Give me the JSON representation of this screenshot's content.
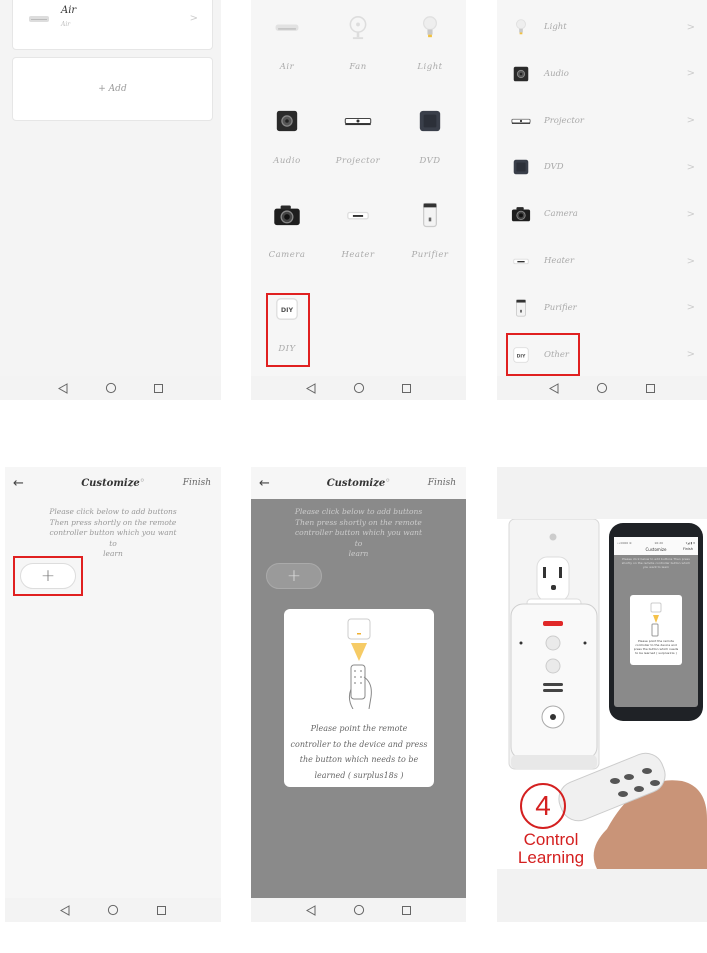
{
  "panel1": {
    "device_name": "Air",
    "device_sub": "Air",
    "chevron": ">",
    "add_label": "+ Add"
  },
  "panel2": {
    "grid": [
      {
        "label": "Air",
        "icon": "air-conditioner-icon"
      },
      {
        "label": "Fan",
        "icon": "fan-icon"
      },
      {
        "label": "Light",
        "icon": "light-bulb-icon"
      },
      {
        "label": "Audio",
        "icon": "audio-speaker-icon"
      },
      {
        "label": "Projector",
        "icon": "projector-icon"
      },
      {
        "label": "DVD",
        "icon": "dvd-icon"
      },
      {
        "label": "Camera",
        "icon": "camera-icon"
      },
      {
        "label": "Heater",
        "icon": "heater-icon"
      },
      {
        "label": "Purifier",
        "icon": "purifier-icon"
      },
      {
        "label": "DIY",
        "icon": "diy-icon"
      }
    ],
    "diy_badge": "DIY"
  },
  "panel3": {
    "list": [
      {
        "label": "Light",
        "icon": "light-bulb-icon"
      },
      {
        "label": "Audio",
        "icon": "audio-speaker-icon"
      },
      {
        "label": "Projector",
        "icon": "projector-icon"
      },
      {
        "label": "DVD",
        "icon": "dvd-icon"
      },
      {
        "label": "Camera",
        "icon": "camera-icon"
      },
      {
        "label": "Heater",
        "icon": "heater-icon"
      },
      {
        "label": "Purifier",
        "icon": "purifier-icon"
      },
      {
        "label": "Other",
        "icon": "diy-icon"
      }
    ],
    "chevron": ">",
    "diy_badge": "DIY"
  },
  "customize": {
    "back": "←",
    "title": "Customize",
    "dot": "°",
    "finish": "Finish",
    "instructions_lines": [
      "Please click below to add buttons",
      "Then press shortly on the remote",
      "controller button which you want to",
      "learn"
    ],
    "add_symbol": "+"
  },
  "dialog": {
    "lines": [
      "Please point the remote",
      "controller to the device and press",
      "the button which needs to be",
      "learned ( surplus18s )"
    ]
  },
  "product": {
    "step_number": "4",
    "caption_line1": "Control",
    "caption_line2": "Learning",
    "phone_title": "Customize",
    "phone_finish": "Finish",
    "phone_status_left": "••0000 ≋",
    "phone_status_time": "16:20",
    "phone_status_right": "▾◢ ▮ 8",
    "phone_instr": "Please click below to add buttons Then press shortly on the remote controller button which you want to learn",
    "phone_dialog": "Please point the remote controller to the device and press the button which needs to be learned ( surplus11s )"
  },
  "colors": {
    "highlight": "#e02020",
    "caption": "#d42020",
    "overlay": "#8a8a8a"
  }
}
